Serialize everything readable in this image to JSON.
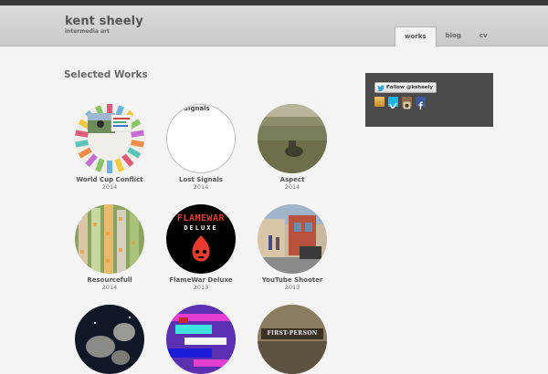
{
  "header": {
    "site_title": "kent sheely",
    "site_subtitle": "intermedia art",
    "nav": [
      {
        "label": "works",
        "active": true
      },
      {
        "label": "blog",
        "active": false
      },
      {
        "label": "cv",
        "active": false
      }
    ]
  },
  "main": {
    "section_title": "Selected Works",
    "works": [
      {
        "title": "World Cup Conflict",
        "year": "2014"
      },
      {
        "title": "Lost Signals",
        "year": "2014",
        "thumb_text": "Signals"
      },
      {
        "title": "Aspect",
        "year": "2014"
      },
      {
        "title": "Resourcefull",
        "year": "2014"
      },
      {
        "title": "FlameWar Deluxe",
        "year": "2013",
        "thumb_text": "FLAMEWAR",
        "thumb_text2": "DELUXE"
      },
      {
        "title": "YouTube Shooter",
        "year": "2013"
      },
      {
        "title": "",
        "year": ""
      },
      {
        "title": "",
        "year": ""
      },
      {
        "title": "",
        "year": "",
        "thumb_text": "FIRST-PERSON"
      }
    ]
  },
  "sidebar": {
    "follow_label": "Follow @ksheely",
    "social_icons": [
      "rss-icon",
      "vimeo-icon",
      "instagram-icon",
      "facebook-icon"
    ]
  },
  "colors": {
    "topbar": "#3a3a3a",
    "sidebar_bg": "#4a4a4a",
    "twitter_blue": "#2fa7e0",
    "vimeo_blue": "#1ab7ea",
    "facebook_blue": "#3b5998"
  }
}
